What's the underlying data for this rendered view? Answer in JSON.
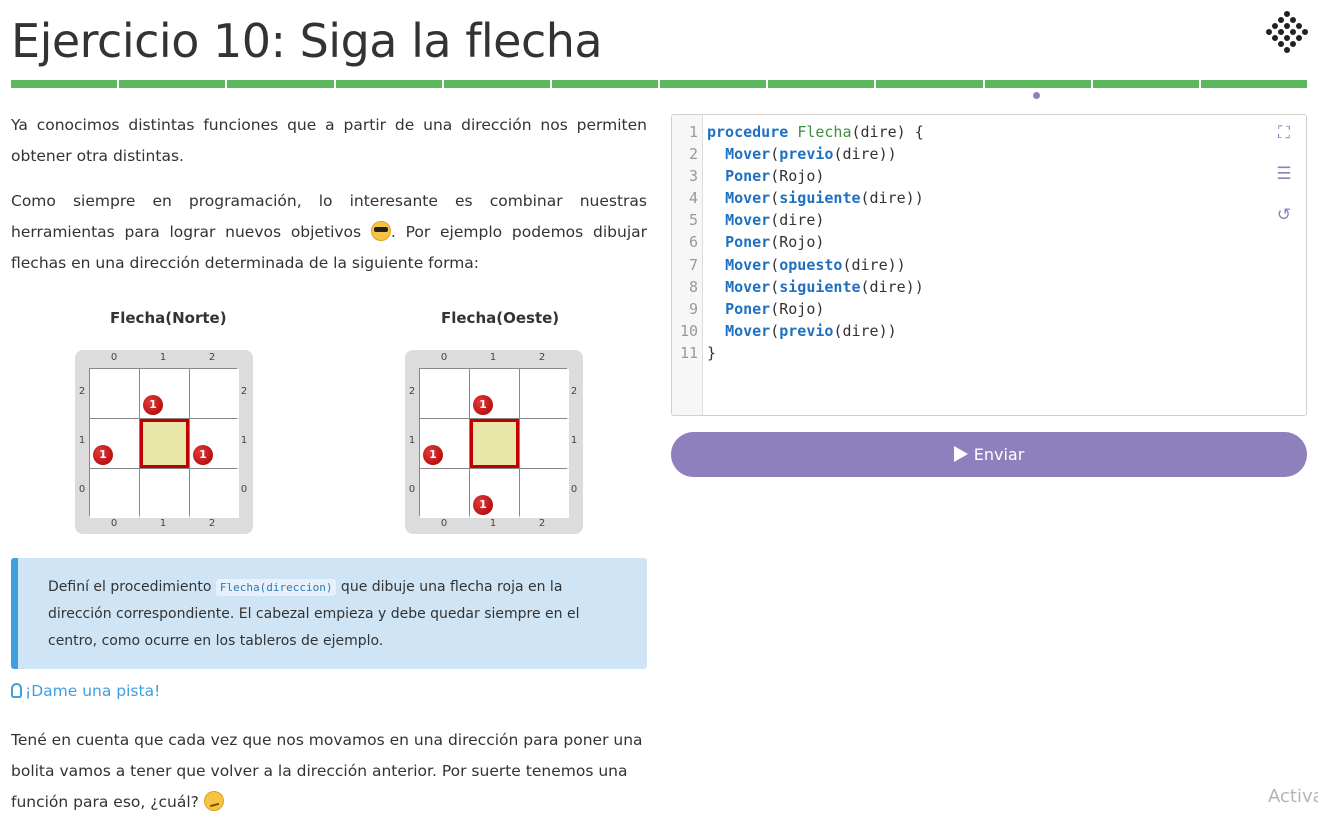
{
  "title": "Ejercicio 10: Siga la flecha",
  "progress": {
    "segments": 12,
    "color": "#5cb85c",
    "current_marker_color": "#8e80bc"
  },
  "intro": {
    "p1": "Ya conocimos distintas funciones que a partir de una dirección nos permiten obtener otra distintas.",
    "p2_a": "Como siempre en programación, lo interesante es combinar nuestras herramientas para lograr nuevos objetivos ",
    "p2_b": ". Por ejemplo podemos dibujar flechas en una dirección determinada de la siguiente forma:"
  },
  "boards": [
    {
      "title": "Flecha(Norte)",
      "cols": [
        "0",
        "1",
        "2"
      ],
      "rows": [
        "2",
        "1",
        "0"
      ],
      "ball_label": "1"
    },
    {
      "title": "Flecha(Oeste)",
      "cols": [
        "0",
        "1",
        "2"
      ],
      "rows": [
        "2",
        "1",
        "0"
      ],
      "ball_label": "1"
    }
  ],
  "callout": {
    "before": "Definí el procedimiento ",
    "code": "Flecha(direccion)",
    "after": " que dibuje una flecha roja en la dirección correspondiente. El cabezal empieza y debe quedar siempre en el centro, como ocurre en los tableros de ejemplo."
  },
  "hint_label": "¡Dame una pista!",
  "hint_text_a": "Tené en cuenta que cada vez que nos movamos en una dirección para poner una bolita vamos a tener que volver a la dirección anterior. Por suerte tenemos una función para eso, ¿cuál? ",
  "editor": {
    "line_numbers": [
      "1",
      "2",
      "3",
      "4",
      "5",
      "6",
      "7",
      "8",
      "9",
      "10",
      "11"
    ],
    "tools": [
      "expand-icon",
      "indent-icon",
      "reset-icon"
    ]
  },
  "send_label": "Enviar",
  "watermark": "Activa"
}
